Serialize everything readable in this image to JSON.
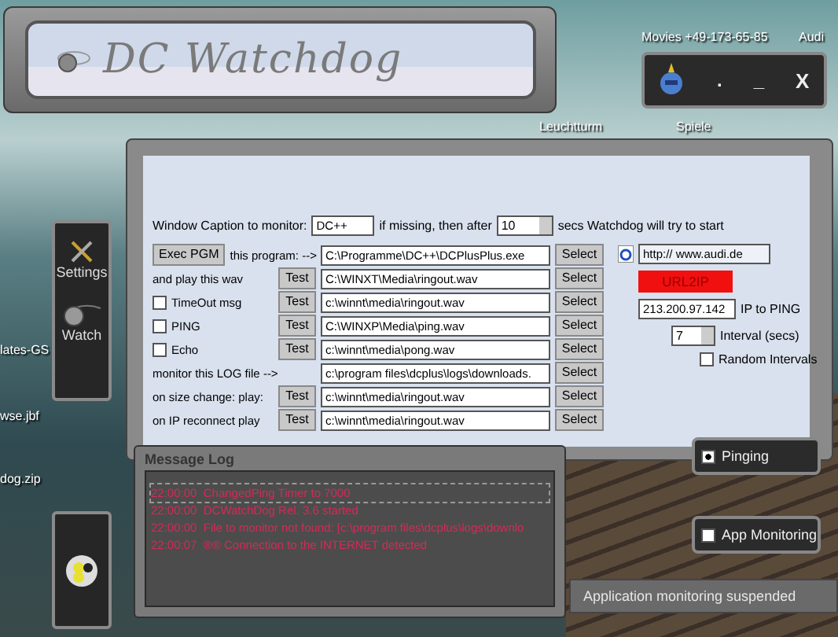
{
  "window": {
    "title": "DC Watchdog"
  },
  "mini_panel": {
    "dot": ".",
    "minimize": "_",
    "close": "X"
  },
  "desktop_icons": [
    {
      "label": "Movies +49-173-65-85"
    },
    {
      "label": "Audi"
    },
    {
      "label": "Leuchtturm"
    },
    {
      "label": "Spiele"
    },
    {
      "label": "lates-GS"
    },
    {
      "label": "wse.jbf"
    },
    {
      "label": "dog.zip"
    }
  ],
  "sidebar": {
    "items": [
      {
        "label": "Settings",
        "kind": "tools"
      },
      {
        "label": "Watch",
        "kind": "ball"
      }
    ]
  },
  "caption": {
    "label": "Window Caption to monitor:",
    "value": "DC++",
    "after_label": "if missing, then after",
    "seconds": "10",
    "suffix": "secs Watchdog will try to start"
  },
  "rows": [
    {
      "kind": "exec",
      "button": "Exec PGM",
      "label": "this program: -->",
      "value": "C:\\Programme\\DC++\\DCPlusPlus.exe",
      "select": "Select"
    },
    {
      "kind": "test",
      "label": "and play this wav",
      "test": "Test",
      "value": "C:\\WINXT\\Media\\ringout.wav",
      "select": "Select"
    },
    {
      "kind": "check",
      "label": "TimeOut msg",
      "checked": false,
      "test": "Test",
      "value": "c:\\winnt\\media\\ringout.wav",
      "select": "Select"
    },
    {
      "kind": "check",
      "label": "PING",
      "checked": false,
      "test": "Test",
      "value": "C:\\WINXP\\Media\\ping.wav",
      "select": "Select"
    },
    {
      "kind": "check",
      "label": "Echo",
      "checked": false,
      "test": "Test",
      "value": "c:\\winnt\\media\\pong.wav",
      "select": "Select"
    },
    {
      "kind": "plain",
      "label": "monitor this LOG file -->",
      "value": "c:\\program files\\dcplus\\logs\\downloads.",
      "select": "Select"
    },
    {
      "kind": "test",
      "label": "on size change: play:",
      "test": "Test",
      "value": "c:\\winnt\\media\\ringout.wav",
      "select": "Select"
    },
    {
      "kind": "test",
      "label": "on IP reconnect play",
      "test": "Test",
      "value": "c:\\winnt\\media\\ringout.wav",
      "select": "Select"
    }
  ],
  "ping": {
    "url": "http:// www.audi.de",
    "url2ip": "URL2IP",
    "ip": "213.200.97.142",
    "ip_label": "IP to PING",
    "interval": "7",
    "interval_label": "Interval (secs)",
    "random": {
      "label": "Random Intervals",
      "checked": false
    }
  },
  "message_log": {
    "title": "Message Log",
    "entries": [
      {
        "time": "22:00:00",
        "text": "ChangedPing Timer to 7000"
      },
      {
        "time": "22:00:00",
        "text": "DCWatchDog Rel. 3.6 started"
      },
      {
        "time": "22:00:00",
        "text": "File to monitor not found: [c:\\program files\\dcplus\\logs\\downlo"
      },
      {
        "time": "22:00:07",
        "text": "®® Connection to the INTERNET detected"
      }
    ]
  },
  "toggles": [
    {
      "label": "Pinging",
      "checked": true
    },
    {
      "label": "App Monitoring",
      "checked": false
    }
  ],
  "status_bar": "Application monitoring suspended"
}
